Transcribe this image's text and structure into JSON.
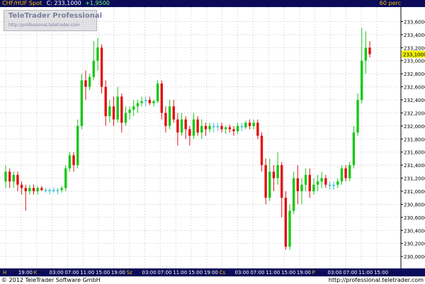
{
  "header": {
    "symbol": "CHF/HUF Spot",
    "price_label": "C: 233,1000",
    "change_label": "+1,9500",
    "period": "60 perc"
  },
  "branding": {
    "name": "TeleTrader Professional",
    "url": "http://professional.teletrader.com"
  },
  "footer": {
    "copyright": "© 2012 TeleTrader Software GmbH",
    "url": "http://professional.teletrader.com"
  },
  "colors": {
    "up": "#18c818",
    "down": "#e01010",
    "flat": "#40c8d8",
    "grid": "#c8c8c8",
    "axis_bg": "#0b0b5a",
    "price_marker": "#f0f000"
  },
  "chart_data": {
    "type": "candlestick",
    "ylim": [
      229.85,
      233.8
    ],
    "y_ticks": [
      "230,0000",
      "230,2000",
      "230,4000",
      "230,6000",
      "230,8000",
      "231,0000",
      "231,2000",
      "231,4000",
      "231,6000",
      "231,8000",
      "232,0000",
      "232,2000",
      "232,4000",
      "232,6000",
      "232,8000",
      "233,0000",
      "233,2000",
      "233,4000",
      "233,6000"
    ],
    "y_tick_values": [
      230.0,
      230.2,
      230.4,
      230.6,
      230.8,
      231.0,
      231.2,
      231.4,
      231.6,
      231.8,
      232.0,
      232.2,
      232.4,
      232.6,
      232.8,
      233.0,
      233.2,
      233.4,
      233.6
    ],
    "current_price_label": "233,1000",
    "current_price": 233.1,
    "x_ticks": [
      "H",
      "19:00",
      "K",
      "03:00",
      "07:00",
      "11:00",
      "15:00",
      "19:00",
      "Sz",
      "03:00",
      "07:00",
      "11:00",
      "15:00",
      "19:00",
      "Cs",
      "03:00",
      "07:00",
      "11:00",
      "15:00",
      "19:00",
      "P",
      "03:00",
      "07:00",
      "11:00",
      "15:00"
    ],
    "grid": true,
    "candles": [
      [
        231.15,
        231.4,
        231.05,
        231.3
      ],
      [
        231.3,
        231.35,
        231.05,
        231.15
      ],
      [
        231.15,
        231.3,
        231.05,
        231.25
      ],
      [
        231.25,
        231.3,
        231.0,
        231.1
      ],
      [
        231.1,
        231.15,
        230.95,
        231.05
      ],
      [
        231.05,
        231.1,
        230.7,
        231.0
      ],
      [
        231.0,
        231.1,
        230.95,
        231.05
      ],
      [
        231.05,
        231.1,
        230.95,
        231.0
      ],
      [
        231.0,
        231.08,
        230.95,
        231.05
      ],
      [
        231.05,
        231.08,
        231.0,
        231.02
      ],
      [
        231.02,
        231.05,
        230.98,
        231.0
      ],
      [
        231.0,
        231.05,
        230.95,
        231.02
      ],
      [
        231.02,
        231.06,
        230.98,
        231.0
      ],
      [
        231.0,
        231.05,
        230.95,
        231.02
      ],
      [
        231.02,
        231.08,
        230.98,
        231.05
      ],
      [
        231.05,
        231.4,
        231.0,
        231.35
      ],
      [
        231.35,
        231.6,
        231.3,
        231.55
      ],
      [
        231.55,
        231.6,
        231.3,
        231.4
      ],
      [
        231.4,
        232.1,
        231.35,
        232.0
      ],
      [
        232.0,
        232.8,
        231.95,
        232.7
      ],
      [
        232.7,
        232.85,
        232.4,
        232.6
      ],
      [
        232.6,
        232.8,
        232.55,
        232.75
      ],
      [
        232.75,
        233.3,
        232.7,
        233.0
      ],
      [
        233.0,
        233.35,
        232.85,
        233.2
      ],
      [
        233.2,
        233.25,
        232.5,
        232.6
      ],
      [
        232.6,
        232.7,
        232.0,
        232.15
      ],
      [
        232.15,
        232.4,
        232.05,
        232.3
      ],
      [
        232.3,
        232.45,
        232.0,
        232.1
      ],
      [
        232.1,
        232.6,
        232.05,
        232.45
      ],
      [
        232.45,
        232.5,
        231.9,
        232.05
      ],
      [
        232.05,
        232.3,
        232.0,
        232.2
      ],
      [
        232.2,
        232.3,
        232.1,
        232.25
      ],
      [
        232.25,
        232.4,
        232.15,
        232.3
      ],
      [
        232.3,
        232.4,
        232.2,
        232.35
      ],
      [
        232.35,
        232.45,
        232.3,
        232.38
      ],
      [
        232.38,
        232.45,
        232.3,
        232.4
      ],
      [
        232.4,
        232.45,
        232.32,
        232.35
      ],
      [
        232.35,
        232.4,
        232.3,
        232.38
      ],
      [
        232.38,
        232.7,
        232.35,
        232.65
      ],
      [
        232.65,
        232.7,
        232.1,
        232.2
      ],
      [
        232.2,
        232.3,
        231.9,
        232.0
      ],
      [
        232.0,
        232.4,
        231.95,
        232.3
      ],
      [
        232.3,
        232.4,
        232.05,
        232.1
      ],
      [
        232.1,
        232.2,
        231.7,
        231.9
      ],
      [
        231.9,
        232.2,
        231.85,
        232.1
      ],
      [
        232.1,
        232.15,
        231.8,
        231.95
      ],
      [
        231.95,
        232.0,
        231.7,
        231.85
      ],
      [
        231.85,
        232.2,
        231.8,
        232.1
      ],
      [
        232.1,
        232.15,
        231.85,
        231.9
      ],
      [
        231.9,
        232.1,
        231.8,
        232.0
      ],
      [
        232.0,
        232.05,
        231.85,
        231.95
      ],
      [
        231.95,
        232.05,
        231.9,
        232.0
      ],
      [
        232.0,
        232.05,
        231.9,
        231.98
      ],
      [
        231.98,
        232.05,
        231.92,
        232.0
      ],
      [
        232.0,
        232.05,
        231.9,
        231.95
      ],
      [
        231.95,
        232.0,
        231.88,
        231.98
      ],
      [
        231.98,
        232.02,
        231.9,
        231.95
      ],
      [
        231.95,
        232.0,
        231.85,
        231.92
      ],
      [
        231.92,
        232.05,
        231.88,
        232.0
      ],
      [
        232.0,
        232.05,
        231.92,
        231.98
      ],
      [
        231.98,
        232.08,
        231.95,
        232.05
      ],
      [
        232.05,
        232.1,
        231.95,
        232.0
      ],
      [
        232.0,
        232.1,
        231.95,
        232.05
      ],
      [
        232.05,
        232.1,
        231.8,
        231.85
      ],
      [
        231.85,
        231.9,
        231.3,
        231.4
      ],
      [
        231.4,
        231.5,
        230.8,
        230.9
      ],
      [
        230.9,
        231.5,
        230.85,
        231.3
      ],
      [
        231.3,
        231.4,
        231.0,
        231.2
      ],
      [
        231.2,
        231.6,
        231.1,
        231.4
      ],
      [
        231.4,
        231.45,
        230.6,
        230.9
      ],
      [
        230.9,
        231.0,
        230.1,
        230.15
      ],
      [
        230.15,
        230.8,
        230.1,
        230.7
      ],
      [
        230.7,
        231.3,
        230.65,
        231.2
      ],
      [
        231.2,
        231.4,
        230.8,
        231.0
      ],
      [
        231.0,
        231.2,
        230.8,
        231.1
      ],
      [
        231.1,
        231.35,
        231.0,
        231.25
      ],
      [
        231.25,
        231.35,
        230.9,
        231.0
      ],
      [
        231.0,
        231.2,
        230.95,
        231.1
      ],
      [
        231.1,
        231.25,
        231.0,
        231.15
      ],
      [
        231.15,
        231.3,
        231.05,
        231.2
      ],
      [
        231.2,
        231.25,
        231.05,
        231.1
      ],
      [
        231.1,
        231.15,
        231.02,
        231.08
      ],
      [
        231.08,
        231.15,
        231.02,
        231.1
      ],
      [
        231.1,
        231.2,
        231.05,
        231.15
      ],
      [
        231.15,
        231.4,
        231.1,
        231.35
      ],
      [
        231.35,
        231.4,
        231.15,
        231.2
      ],
      [
        231.2,
        231.45,
        231.15,
        231.4
      ],
      [
        231.4,
        232.0,
        231.35,
        231.9
      ],
      [
        231.9,
        232.5,
        231.85,
        232.4
      ],
      [
        232.4,
        233.5,
        232.35,
        233.0
      ],
      [
        233.0,
        233.45,
        232.8,
        233.2
      ],
      [
        233.2,
        233.3,
        233.05,
        233.1
      ]
    ]
  }
}
